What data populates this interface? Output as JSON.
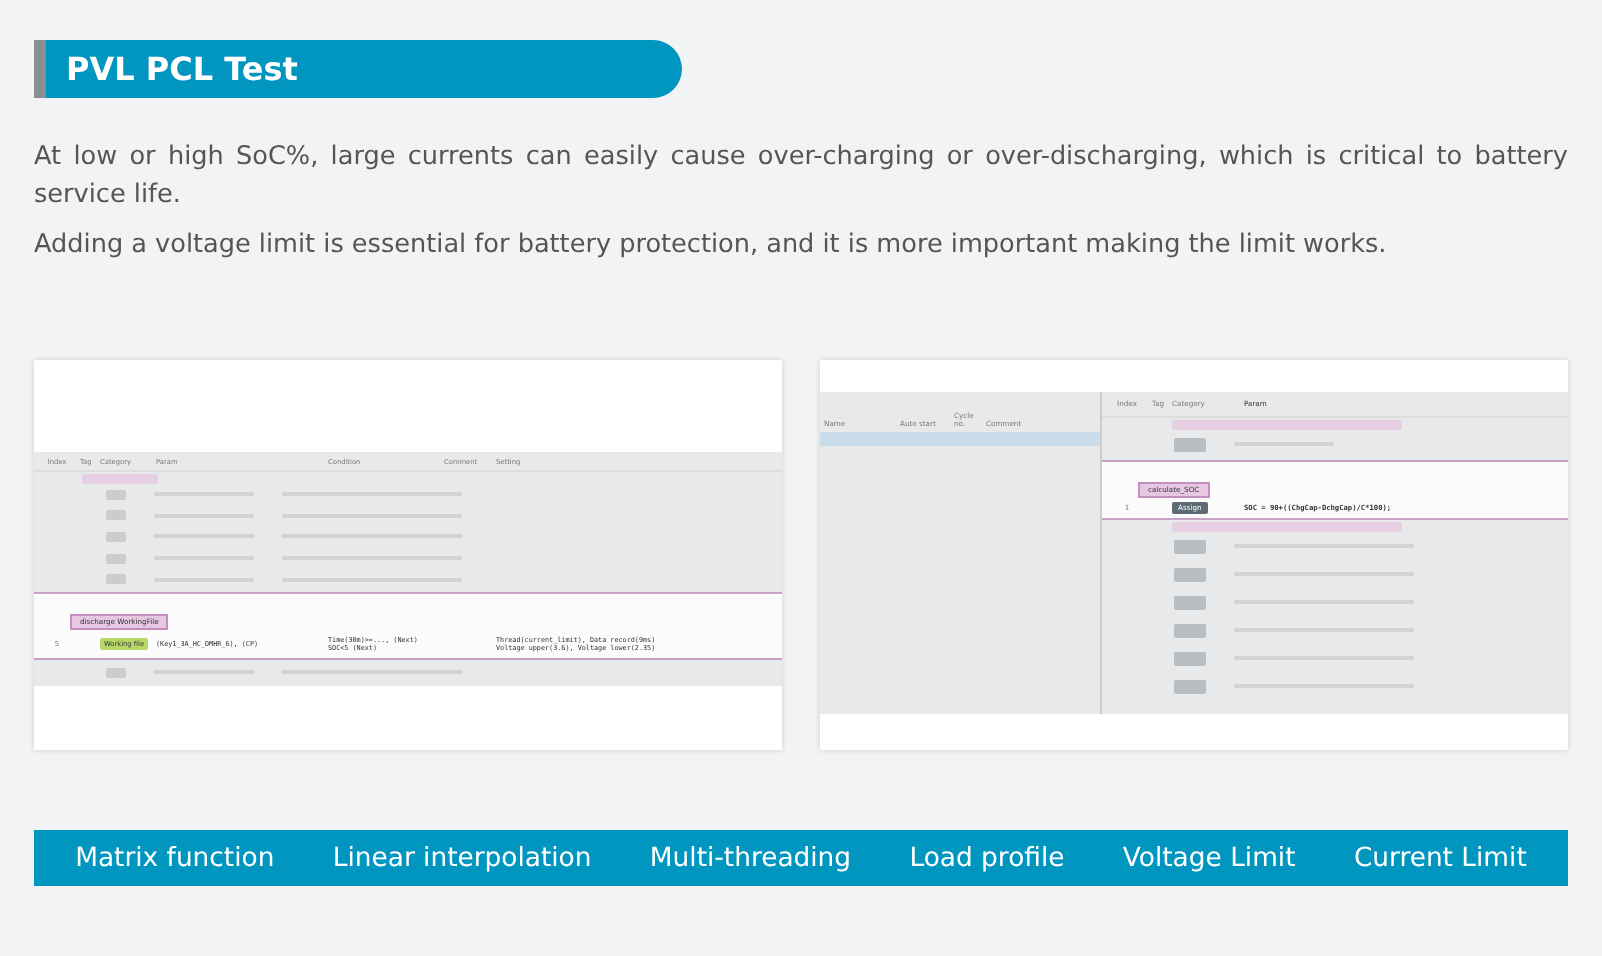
{
  "section_title": "PVL PCL Test",
  "paragraphs": [
    "At low or high SoC%, large currents can easily cause over-charging or over-discharging, which is critical to battery service life.",
    "Adding a voltage limit is essential for battery protection, and it is more important making the limit works."
  ],
  "left_screenshot": {
    "columns": [
      "Index",
      "Tag",
      "Category",
      "Param",
      "Condition",
      "Comment",
      "Setting"
    ],
    "group_label": "discharge WorkingFile",
    "row": {
      "index": "5",
      "category": "Working file",
      "param": "(Key1_3A_HC_DMHR_6), (CP)",
      "condition": [
        "Time(30m)>=..., (Next)",
        "SOC<5 (Next)"
      ],
      "setting": [
        "Thread(current_limit), Data record(9ms)",
        "Voltage upper(3.6), Voltage lower(2.35)"
      ]
    }
  },
  "right_screenshot": {
    "file_columns": [
      "Name",
      "Auto start",
      "Cycle no.",
      "Comment"
    ],
    "step_columns": [
      "Index",
      "Tag",
      "Category",
      "Param"
    ],
    "group_label": "calculate_SOC",
    "row": {
      "index": "1",
      "category": "Assign",
      "param": "SOC = 90+((ChgCap-DchgCap)/C*100);"
    }
  },
  "features": [
    "Matrix function",
    "Linear interpolation",
    "Multi-threading",
    "Load profile",
    "Voltage Limit",
    "Current Limit"
  ]
}
